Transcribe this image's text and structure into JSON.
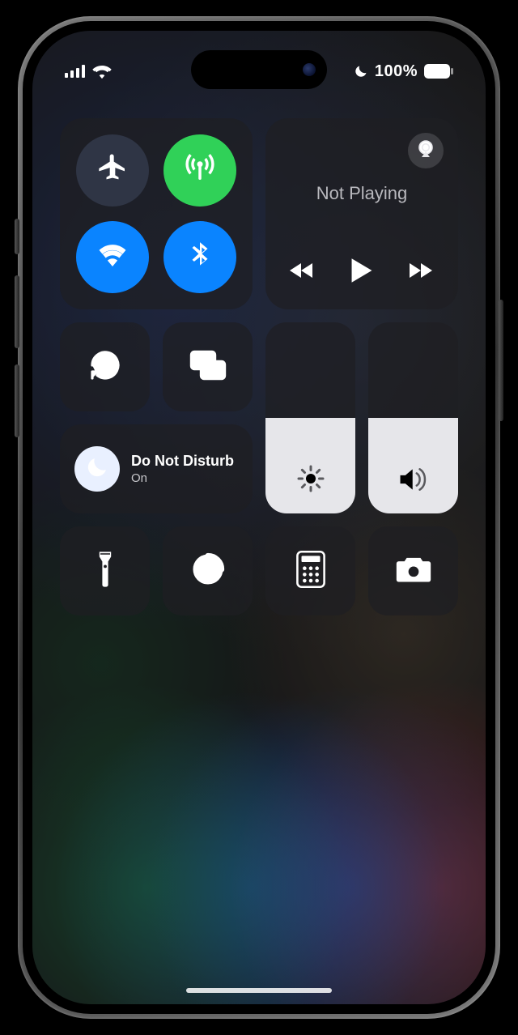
{
  "status": {
    "focus_icon": "moon",
    "battery_percent_label": "100%",
    "battery_level": 100
  },
  "connectivity": {
    "airplane": {
      "on": false
    },
    "cellular": {
      "on": true
    },
    "wifi": {
      "on": true
    },
    "bluetooth": {
      "on": true
    }
  },
  "media": {
    "title": "Not Playing"
  },
  "focus": {
    "title": "Do Not Disturb",
    "status": "On"
  },
  "sliders": {
    "brightness_pct": 50,
    "volume_pct": 50
  },
  "shortcuts": {
    "flashlight": "flashlight",
    "timer": "timer",
    "calculator": "calculator",
    "camera": "camera"
  }
}
